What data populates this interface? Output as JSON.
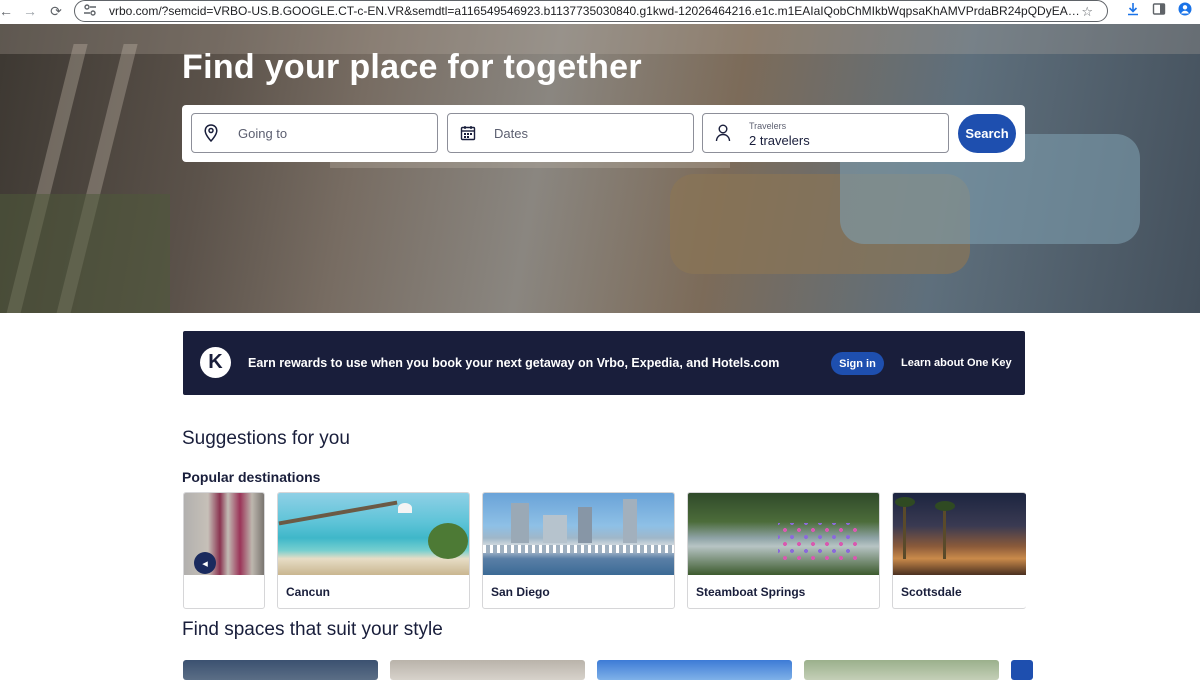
{
  "browser": {
    "url": "vrbo.com/?semcid=VRBO-US.B.GOOGLE.CT-c-EN.VR&semdtl=a116549546923.b1137735030840.g1kwd-12026464216.e1c.m1EAIaIQobChMIkbWqpsaKhAMVPrdaBR24pQDyEAAYASAAEgIRlPD_BwE.r1ca4..."
  },
  "hero": {
    "title": "Find your place for together",
    "search": {
      "destination_placeholder": "Going to",
      "dates_placeholder": "Dates",
      "travelers_label": "Travelers",
      "travelers_value": "2 travelers",
      "search_label": "Search"
    }
  },
  "onekey_banner": {
    "text": "Earn rewards to use when you book your next getaway on Vrbo, Expedia, and Hotels.com",
    "signin_label": "Sign in",
    "learn_label": "Learn about One Key"
  },
  "suggestions": {
    "title": "Suggestions for you",
    "popular_title": "Popular destinations",
    "destinations": [
      {
        "name": ""
      },
      {
        "name": "Cancun"
      },
      {
        "name": "San Diego"
      },
      {
        "name": "Steamboat Springs"
      },
      {
        "name": "Scottsdale"
      }
    ]
  },
  "styles": {
    "title": "Find spaces that suit your style"
  },
  "colors": {
    "brand_blue": "#1e4faf",
    "navy": "#191e3b"
  }
}
